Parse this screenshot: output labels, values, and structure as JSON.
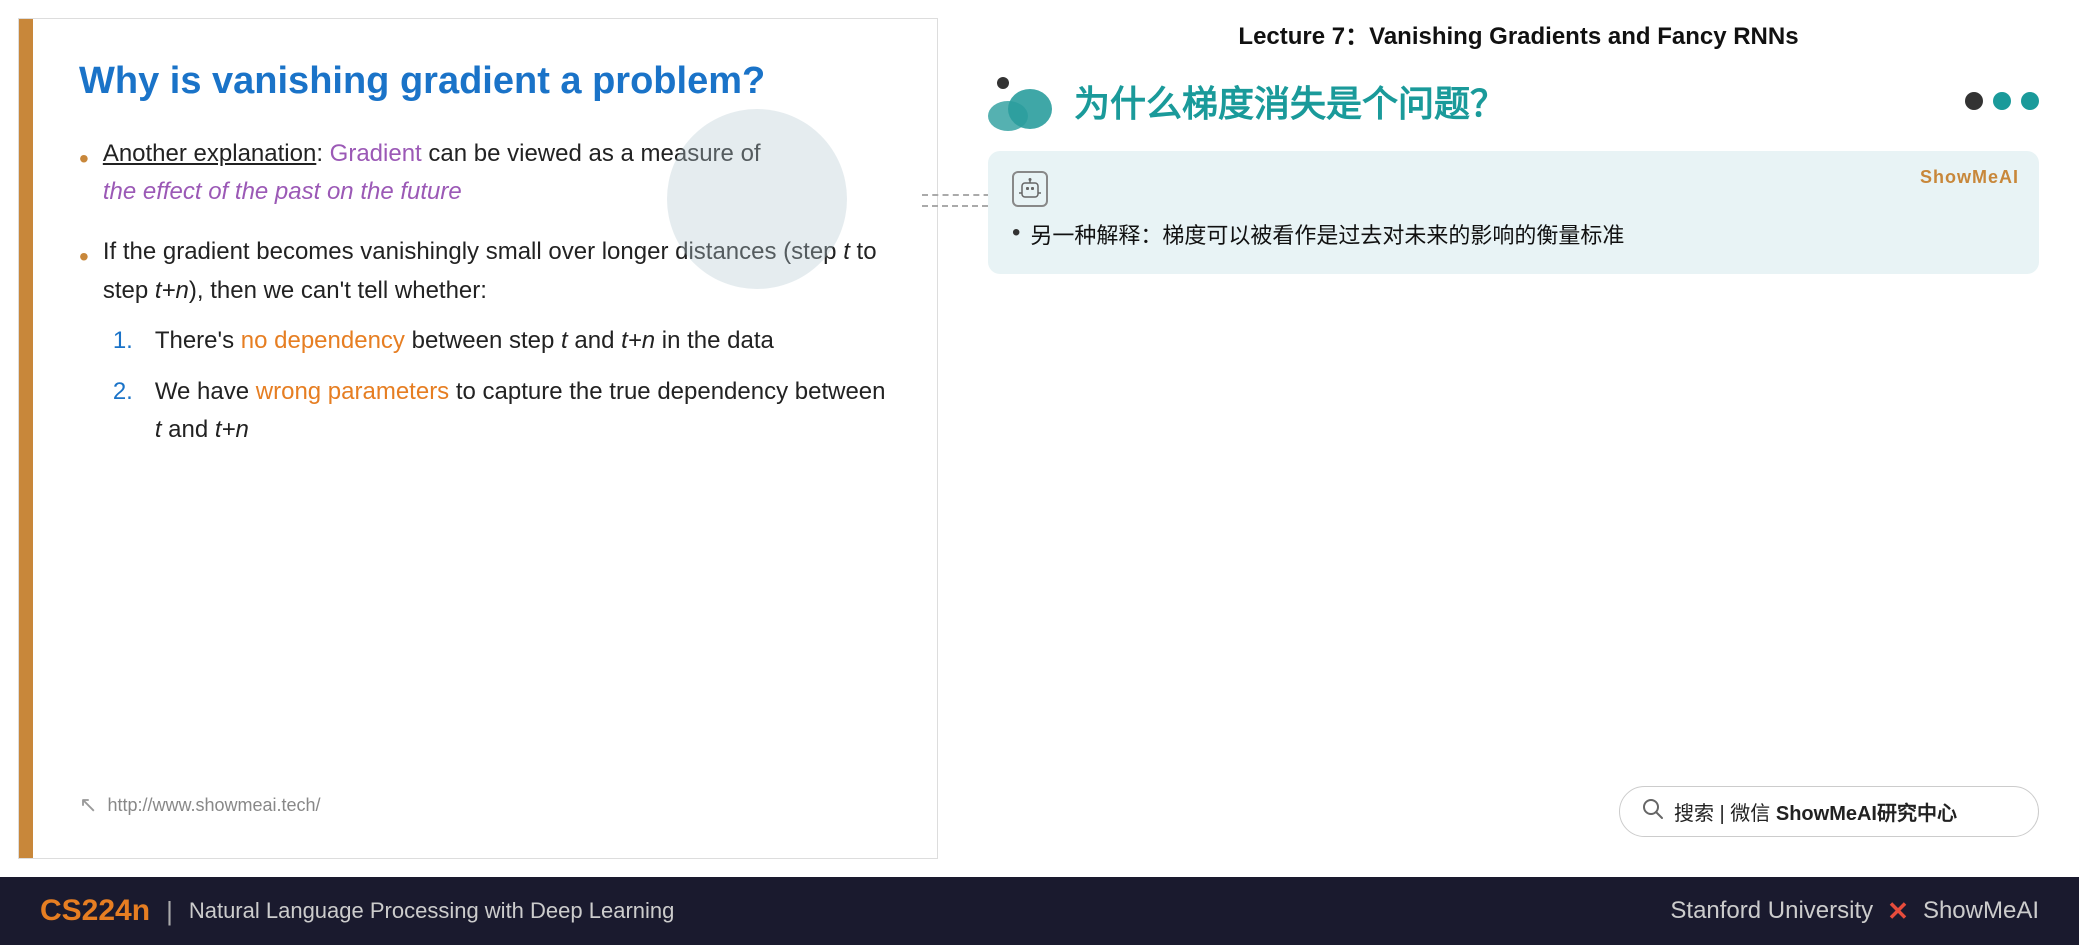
{
  "lecture": {
    "title": "Lecture 7：Vanishing Gradients and Fancy RNNs"
  },
  "slide": {
    "title": "Why is vanishing gradient a problem?",
    "bullets": [
      {
        "id": 1,
        "prefix_plain": "Another explanation",
        "prefix_colored": "Gradient",
        "text_after": " can be viewed as a measure of",
        "italic_line": "the effect of the past on the future"
      },
      {
        "id": 2,
        "text": "If the gradient becomes vanishingly small over longer distances (step t to step t+n), then we can't tell whether:",
        "sub_items": [
          {
            "num": "1.",
            "before": "There's ",
            "colored": "no dependency",
            "after": " between step t and t+n in the data"
          },
          {
            "num": "2.",
            "before": "We have ",
            "colored": "wrong parameters",
            "after": " to capture the true dependency between t and t+n"
          }
        ]
      }
    ],
    "footer_url": "http://www.showmeai.tech/"
  },
  "right_panel": {
    "chinese_title": "为什么梯度消失是个问题？",
    "translation_card": {
      "badge": "ShowMeAI",
      "text": "另一种解释：梯度可以被看作是过去对未来的影响的衡量标准"
    },
    "search_bar": {
      "text": "搜索 | 微信 ShowMeAI研究中心"
    }
  },
  "bottom_bar": {
    "course_code": "CS224n",
    "separator": "|",
    "subtitle": "Natural Language Processing with Deep Learning",
    "right": "Stanford University",
    "x_symbol": "✕",
    "brand": "ShowMeAI"
  },
  "dots": [
    {
      "color": "dark"
    },
    {
      "color": "teal"
    },
    {
      "color": "teal"
    }
  ]
}
